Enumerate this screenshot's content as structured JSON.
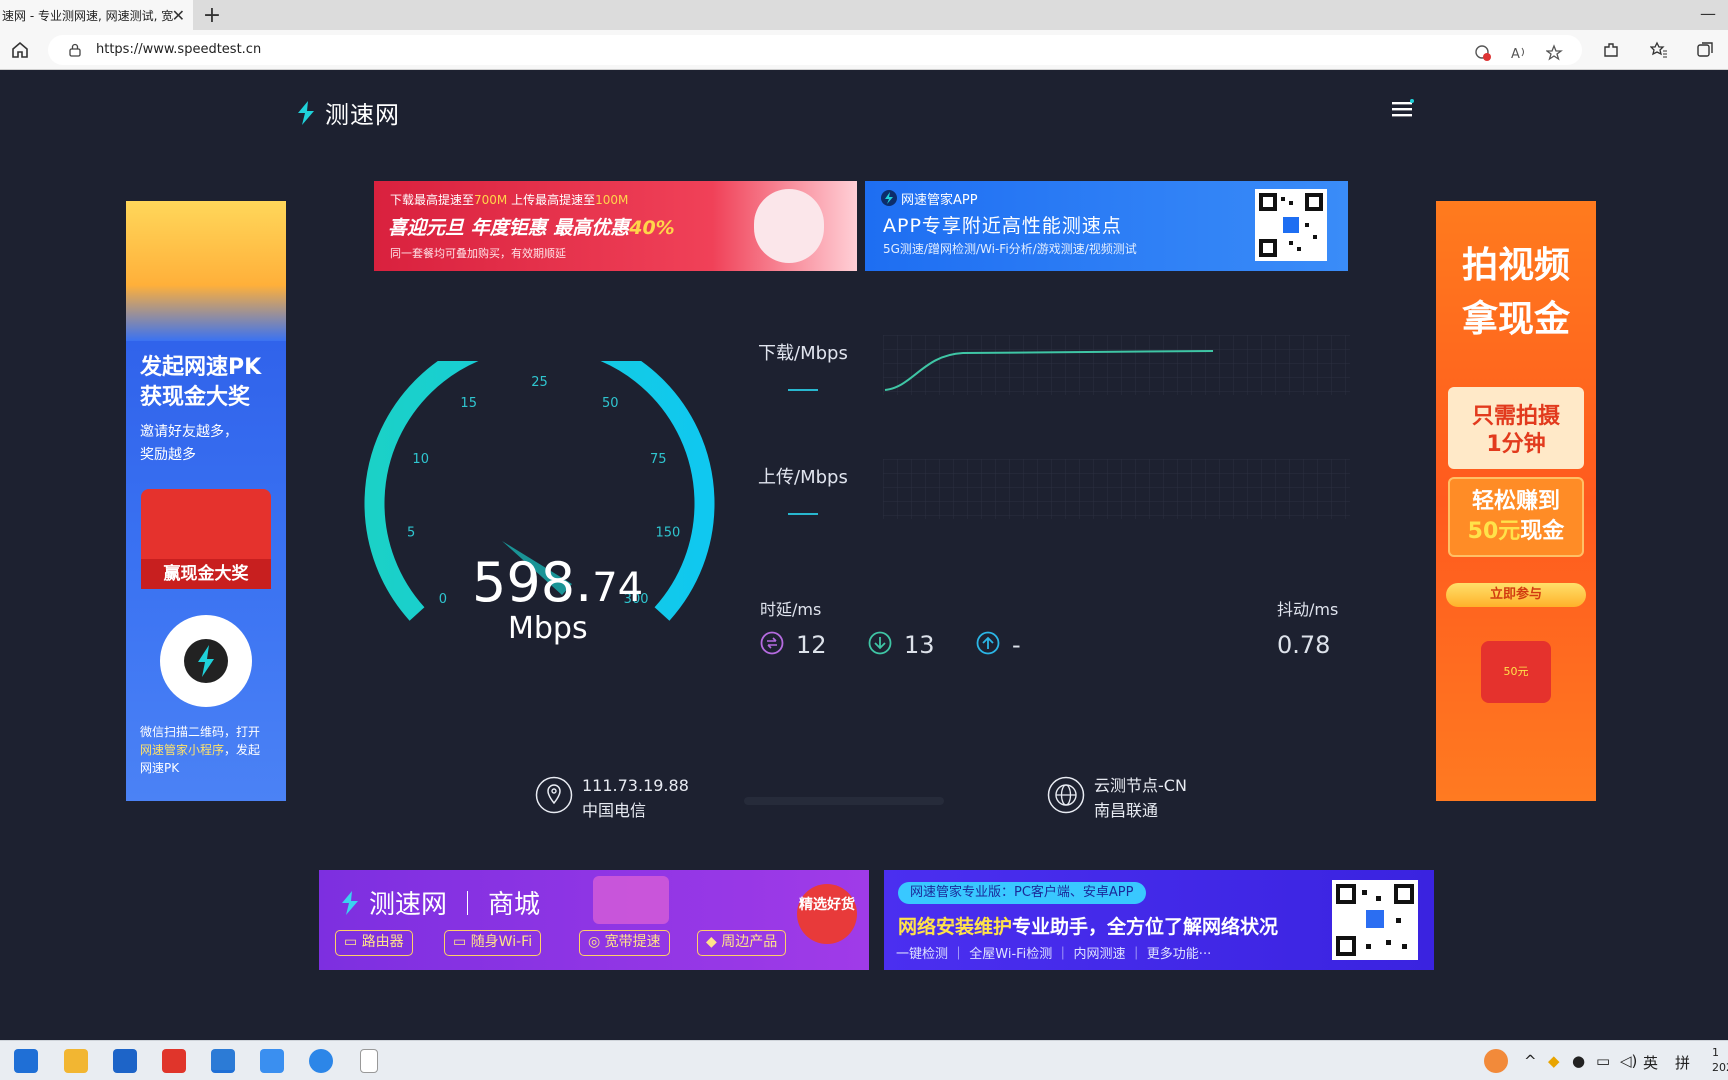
{
  "browser": {
    "tab_title": "速网 - 专业测网速, 网速测试, 宽",
    "url": "https://www.speedtest.cn"
  },
  "site": {
    "logo_text": "测速网"
  },
  "ad_left": {
    "title_line1": "发起网速PK",
    "title_line2": "获现金大奖",
    "sub_line1": "邀请好友越多，",
    "sub_line2": "奖励越多",
    "bag_label": "赢现金大奖",
    "foot_1": "微信扫描二维码，打开",
    "foot_2": "网速管家小程序",
    "foot_3": "，发起",
    "foot_4": "网速PK"
  },
  "ad_right": {
    "h1": "拍视频",
    "h2": "拿现金",
    "env1": "只需拍摄",
    "env2": "1分钟",
    "c1": "轻松赚到",
    "c2a": "50元",
    "c2b": "现金",
    "join": "立即参与",
    "small": "50元"
  },
  "banner_promo": {
    "l1a": "下载最高提速至",
    "l1b": "700M",
    "l1c": " 上传最高提速至",
    "l1d": "100M",
    "l2a": "喜迎元旦  年度钜惠  最高优惠",
    "l2b": "40%",
    "l3": "同一套餐均可叠加购买，有效期顺延"
  },
  "banner_app": {
    "brand": "网速管家APP",
    "headline": "APP专享附近高性能测速点",
    "sub": "5G测速/蹭网检测/Wi-Fi分析/游戏测速/视频测试"
  },
  "gauge": {
    "ticks": [
      "0",
      "5",
      "10",
      "15",
      "25",
      "50",
      "75",
      "150",
      "300"
    ],
    "speed_int": "598.",
    "speed_dec": "74",
    "unit": "Mbps",
    "max": 300,
    "current_mbps": 598.74
  },
  "metrics": {
    "download_label": "下载/Mbps",
    "upload_label": "上传/Mbps",
    "latency_label": "时延/ms",
    "jitter_label": "抖动/ms",
    "ping": "12",
    "download_ping": "13",
    "upload_ping": "-",
    "jitter": "0.78"
  },
  "client": {
    "ip": "111.73.19.88",
    "isp": "中国电信"
  },
  "server": {
    "name": "云测节点-CN",
    "isp": "南昌联通"
  },
  "banner_shop": {
    "brand": "测速网",
    "shop": "商城",
    "seal": "精选好货",
    "p1": "路由器",
    "p2": "随身Wi-Fi",
    "p3": "宽带提速",
    "p4": "周边产品"
  },
  "banner_pro": {
    "tag": "网速管家专业版：PC客户端、安卓APP",
    "h_a": "网络安装维护",
    "h_b": "专业助手，全方位了解网络状况",
    "sub": "一键检测  ｜  全屋Wi-Fi检测  ｜  内网测速  ｜  更多功能···"
  },
  "taskbar": {
    "lang": "英",
    "ime": "拼",
    "clock_1": "1",
    "clock_2": "202"
  },
  "colors": {
    "page_bg": "#1d2130",
    "accent_cyan": "#1fd1d9",
    "gauge_start": "#1bd1c7",
    "gauge_end": "#10c8f0"
  }
}
